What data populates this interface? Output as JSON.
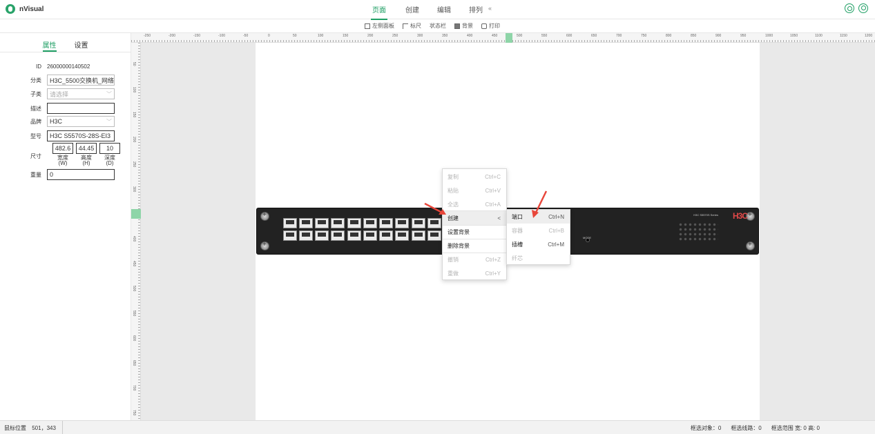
{
  "app": {
    "name": "nVisual"
  },
  "nav": {
    "items": [
      {
        "label": "页面",
        "active": true
      },
      {
        "label": "创建",
        "active": false
      },
      {
        "label": "编辑",
        "active": false
      },
      {
        "label": "排列",
        "active": false
      }
    ],
    "collapse_glyph": "«"
  },
  "toolbar": {
    "items": [
      {
        "label": "左侧面板",
        "icon": "panel-icon"
      },
      {
        "label": "标尺",
        "icon": "ruler-icon"
      },
      {
        "label": "状态栏",
        "icon": ""
      },
      {
        "label": "背景",
        "icon": "background-icon"
      },
      {
        "label": "打印",
        "icon": "print-icon"
      }
    ]
  },
  "left_panel": {
    "tabs": [
      {
        "label": "属性",
        "active": true
      },
      {
        "label": "设置",
        "active": false
      }
    ],
    "fields": {
      "id_label": "ID",
      "id_value": "26000000140502",
      "category_label": "分类",
      "category_value": "H3C_5500交换机_网络",
      "subtype_label": "子类",
      "subtype_placeholder": "请选择",
      "desc_label": "描述",
      "desc_value": "",
      "brand_label": "品牌",
      "brand_value": "H3C",
      "model_label": "型号",
      "model_value": "H3C S5570S-28S-EI3",
      "size_label": "尺寸",
      "width_value": "482.6",
      "height_value": "44.45",
      "depth_value": "10",
      "width_label": "宽度\n(W)",
      "height_label": "高度\n(H)",
      "depth_label": "深度\n(D)",
      "weight_label": "重量",
      "weight_value": "0"
    }
  },
  "ruler": {
    "h_marks": [
      "-250",
      "-200",
      "-150",
      "-100",
      "-50",
      "0",
      "50",
      "100",
      "150",
      "200",
      "250",
      "300",
      "350",
      "400",
      "450",
      "500",
      "550",
      "600",
      "650",
      "700",
      "750",
      "800",
      "850",
      "900",
      "950",
      "1000",
      "1050",
      "1100",
      "1150",
      "1200"
    ],
    "v_marks": [
      "50",
      "100",
      "150",
      "200",
      "250",
      "300",
      "350",
      "400",
      "450",
      "500",
      "550",
      "600",
      "650",
      "700",
      "750"
    ]
  },
  "device": {
    "brand": "H3C",
    "series": "H3C S5570S Series",
    "mode_label": "MODE"
  },
  "context_menu": {
    "items": [
      {
        "label": "复制",
        "shortcut": "Ctrl+C",
        "disabled": true
      },
      {
        "label": "粘贴",
        "shortcut": "Ctrl+V",
        "disabled": true
      },
      {
        "label": "全选",
        "shortcut": "Ctrl+A",
        "disabled": true
      },
      {
        "label": "创建",
        "shortcut": "<",
        "disabled": false,
        "hover": true
      },
      {
        "label": "设置背景",
        "shortcut": "",
        "disabled": false
      },
      {
        "label": "删除背景",
        "shortcut": "",
        "disabled": false
      },
      {
        "label": "撤销",
        "shortcut": "Ctrl+Z",
        "disabled": true
      },
      {
        "label": "重做",
        "shortcut": "Ctrl+Y",
        "disabled": true
      }
    ]
  },
  "submenu": {
    "items": [
      {
        "label": "端口",
        "shortcut": "Ctrl+N",
        "disabled": false,
        "hover": true
      },
      {
        "label": "容器",
        "shortcut": "Ctrl+B",
        "disabled": true
      },
      {
        "label": "插槽",
        "shortcut": "Ctrl+M",
        "disabled": false
      },
      {
        "label": "纤芯",
        "shortcut": "",
        "disabled": true
      }
    ]
  },
  "statusbar": {
    "mouse_label": "鼠标位置",
    "mouse_value": "501，343",
    "selected_objects": "框选对象：0",
    "selected_lines": "框选线路：0",
    "selection_range": "框选范围 宽: 0 高: 0"
  },
  "colors": {
    "accent": "#1d9e63",
    "arrow": "#e8473b"
  }
}
